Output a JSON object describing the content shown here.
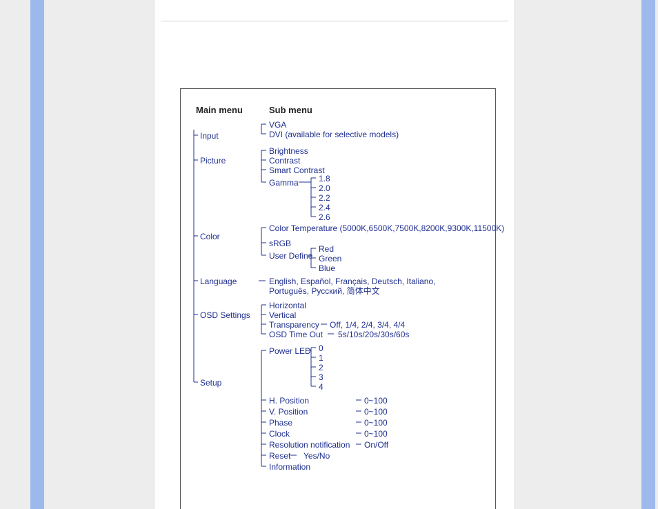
{
  "headers": {
    "main": "Main menu",
    "sub": "Sub menu"
  },
  "input": {
    "label": "Input",
    "vga": "VGA",
    "dvi": "DVI (available for selective models)"
  },
  "picture": {
    "label": "Picture",
    "brightness": "Brightness",
    "contrast": "Contrast",
    "smart": "Smart Contrast",
    "gamma": {
      "label": "Gamma",
      "v0": "1.8",
      "v1": "2.0",
      "v2": "2.2",
      "v3": "2.4",
      "v4": "2.6"
    }
  },
  "color": {
    "label": "Color",
    "temp": "Color Temperature (5000K,6500K,7500K,8200K,9300K,11500K)",
    "srgb": "sRGB",
    "user": {
      "label": "User Define",
      "r": "Red",
      "g": "Green",
      "b": "Blue"
    }
  },
  "language": {
    "label": "Language",
    "value": "English, Español, Français, Deutsch, Italiano, Português, Русский, 简体中文"
  },
  "osd": {
    "label": "OSD Settings",
    "h": "Horizontal",
    "v": "Vertical",
    "transparency": {
      "label": "Transparency",
      "vals": "Off, 1/4, 2/4, 3/4, 4/4"
    },
    "timeout": {
      "label": "OSD Time Out",
      "vals": "5s/10s/20s/30s/60s"
    }
  },
  "setup": {
    "label": "Setup",
    "powerled": {
      "label": "Power LED",
      "v0": "0",
      "v1": "1",
      "v2": "2",
      "v3": "3",
      "v4": "4"
    },
    "hpos": {
      "label": "H. Position",
      "range": "0~100"
    },
    "vpos": {
      "label": "V. Position",
      "range": "0~100"
    },
    "phase": {
      "label": "Phase",
      "range": "0~100"
    },
    "clock": {
      "label": "Clock",
      "range": "0~100"
    },
    "resnotif": {
      "label": "Resolution notification",
      "vals": "On/Off"
    },
    "reset": {
      "label": "Reset",
      "vals": "Yes/No"
    },
    "info": "Information"
  }
}
